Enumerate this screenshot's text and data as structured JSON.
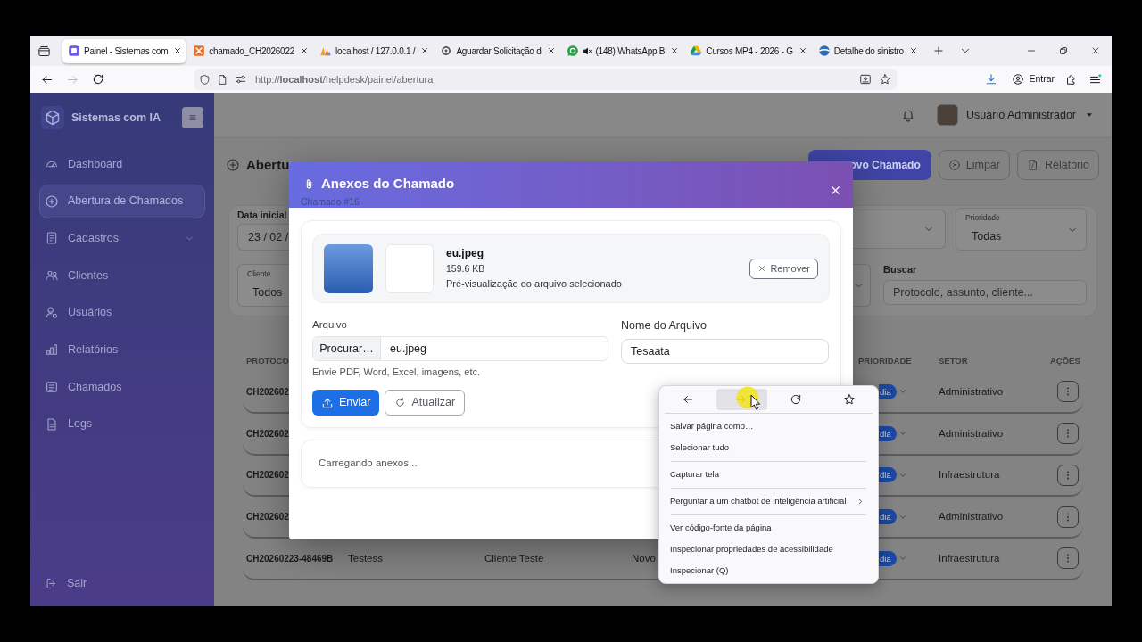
{
  "browser": {
    "tabs": [
      {
        "label": "Painel - Sistemas com",
        "selected": true,
        "muted": false
      },
      {
        "label": "chamado_CH2026022",
        "selected": false,
        "muted": false
      },
      {
        "label": "localhost / 127.0.0.1 /",
        "selected": false,
        "muted": false
      },
      {
        "label": "Aguardar Solicitação d",
        "selected": false,
        "muted": false
      },
      {
        "label": "(148) WhatsApp B",
        "selected": false,
        "muted": true
      },
      {
        "label": "Cursos MP4 - 2026 - G",
        "selected": false,
        "muted": false
      },
      {
        "label": "Detalhe do sinistro",
        "selected": false,
        "muted": false
      }
    ],
    "url": "http://**localhost**/helpdesk/painel/abertura",
    "forward_disabled": true,
    "account_label": "Entrar"
  },
  "sidebar": {
    "brand": "Sistemas com IA",
    "items": [
      {
        "label": "Dashboard",
        "kind": "link",
        "selected": false
      },
      {
        "label": "Abertura de Chamados",
        "kind": "link",
        "selected": true
      },
      {
        "label": "Cadastros",
        "kind": "group",
        "selected": false
      },
      {
        "label": "Clientes",
        "kind": "link",
        "selected": false
      },
      {
        "label": "Usuários",
        "kind": "link",
        "selected": false
      },
      {
        "label": "Relatórios",
        "kind": "link",
        "selected": false
      },
      {
        "label": "Chamados",
        "kind": "link",
        "selected": false
      },
      {
        "label": "Logs",
        "kind": "link",
        "selected": false
      }
    ],
    "logout": "Sair"
  },
  "header": {
    "user_name": "Usuário Administrador"
  },
  "page": {
    "title": "Abertu",
    "actions": [
      {
        "label": "ovo Chamado",
        "kind": "primary"
      },
      {
        "label": "Limpar",
        "kind": "outline"
      },
      {
        "label": "Relatório",
        "kind": "outline"
      }
    ]
  },
  "filters": {
    "start_date": {
      "label": "Data inicial",
      "value": "23 / 02 /"
    },
    "priority": {
      "label": "Prioridade",
      "value": "Todas"
    },
    "client": {
      "label": "Cliente",
      "value": "Todos"
    },
    "search": {
      "label": "Buscar",
      "placeholder": "Protocolo, assunto, cliente..."
    }
  },
  "table": {
    "columns": [
      "PROTOCO",
      "PRIORIDADE",
      "SETOR",
      "AÇÕES"
    ],
    "rows": [
      {
        "protocol": "CH202602",
        "priority": "dia",
        "sector": "Administrativo"
      },
      {
        "protocol": "CH202602",
        "priority": "dia",
        "sector": "Administrativo"
      },
      {
        "protocol": "CH202602",
        "priority": "dia",
        "sector": "Infraestrutura"
      },
      {
        "protocol": "CH202602",
        "priority": "dia",
        "sector": "Administrativo"
      },
      {
        "protocol": "CH20260223-48469B",
        "subject": "Testess",
        "client": "Cliente Teste",
        "status": "Novo",
        "priority": "dia",
        "sector": "Infraestrutura"
      }
    ]
  },
  "modal": {
    "title": "Anexos do Chamado",
    "subtitle": "Chamado #16",
    "file": {
      "name": "eu.jpeg",
      "size": "159.6 KB",
      "caption": "Pré-visualização do arquivo selecionado",
      "remove_label": "Remover"
    },
    "file_input": {
      "label": "Arquivo",
      "button": "Procurar…",
      "value": "eu.jpeg",
      "hint": "Envie PDF, Word, Excel, imagens, etc."
    },
    "name_input": {
      "label": "Nome do Arquivo",
      "value": "Tesaata"
    },
    "buttons": [
      {
        "label": "Enviar",
        "kind": "primary"
      },
      {
        "label": "Atualizar",
        "kind": "outline"
      }
    ],
    "loading_text": "Carregando anexos..."
  },
  "context_menu": {
    "nav_actions": [
      {
        "highlighted": false
      },
      {
        "highlighted": true
      },
      {
        "highlighted": false
      },
      {
        "highlighted": false
      }
    ],
    "items": [
      {
        "label": "Salvar página como…",
        "kind": "item"
      },
      {
        "label": "Selecionar tudo",
        "kind": "item"
      },
      {
        "kind": "separator"
      },
      {
        "label": "Capturar tela",
        "kind": "item"
      },
      {
        "kind": "separator"
      },
      {
        "label": "Perguntar a um chatbot de inteligência artificial",
        "kind": "submenu"
      },
      {
        "kind": "separator"
      },
      {
        "label": "Ver código-fonte da página",
        "kind": "item"
      },
      {
        "label": "Inspecionar propriedades de acessibilidade",
        "kind": "item"
      },
      {
        "label": "Inspecionar (Q)",
        "kind": "item"
      }
    ]
  }
}
